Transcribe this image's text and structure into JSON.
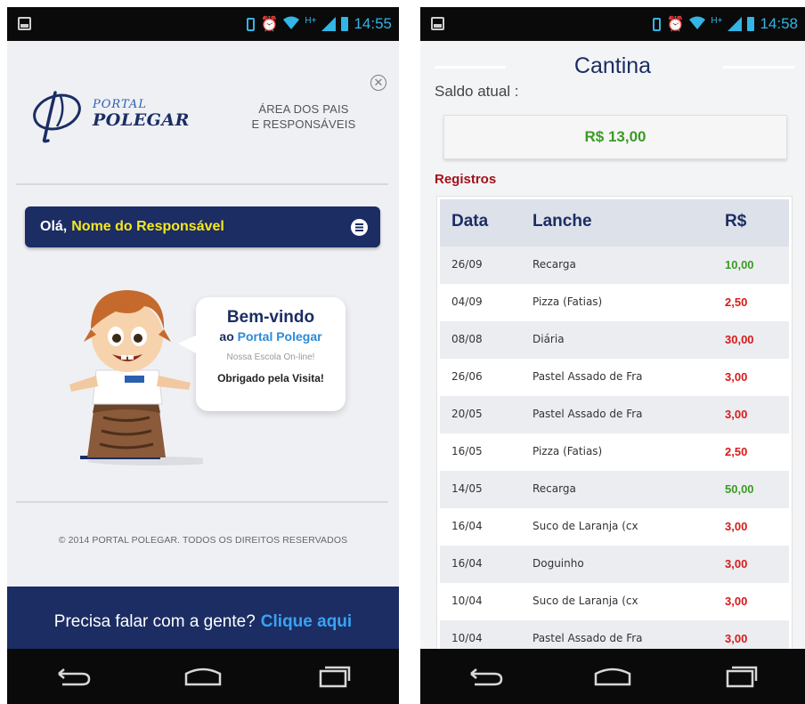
{
  "status_left": {
    "time": "14:55",
    "network": "H+"
  },
  "status_right": {
    "time": "14:58",
    "network": "H+"
  },
  "portal": {
    "logo_line1": "PORTAL",
    "logo_line2": "POLEGAR",
    "area_line1": "ÁREA DOS PAIS",
    "area_line2": "E RESPONSÁVEIS",
    "close_symbol": "✕",
    "greeting_prefix": "Olá,",
    "greeting_name": "Nome do Responsável",
    "bubble_title": "Bem-vindo",
    "bubble_sub_prefix": "ao",
    "bubble_sub_highlight": "Portal Polegar",
    "bubble_tagline": "Nossa Escola On-line!",
    "bubble_thanks": "Obrigado pela Visita!",
    "copyright": "© 2014 PORTAL POLEGAR. TODOS OS DIREITOS RESERVADOS",
    "contact_text": "Precisa falar com a gente?",
    "contact_link": "Clique aqui"
  },
  "cantina": {
    "title": "Cantina",
    "saldo_label": "Saldo atual :",
    "saldo_value": "R$ 13,00",
    "registros_label": "Registros",
    "columns": [
      "Data",
      "Lanche",
      "R$"
    ],
    "rows": [
      {
        "data": "26/09",
        "lanche": "Recarga",
        "valor": "10,00",
        "type": "pos"
      },
      {
        "data": "04/09",
        "lanche": "Pizza (Fatias)",
        "valor": "2,50",
        "type": "neg"
      },
      {
        "data": "08/08",
        "lanche": "Diária",
        "valor": "30,00",
        "type": "neg"
      },
      {
        "data": "26/06",
        "lanche": "Pastel Assado de Fra",
        "valor": "3,00",
        "type": "neg"
      },
      {
        "data": "20/05",
        "lanche": "Pastel Assado de Fra",
        "valor": "3,00",
        "type": "neg"
      },
      {
        "data": "16/05",
        "lanche": "Pizza (Fatias)",
        "valor": "2,50",
        "type": "neg"
      },
      {
        "data": "14/05",
        "lanche": "Recarga",
        "valor": "50,00",
        "type": "pos"
      },
      {
        "data": "16/04",
        "lanche": "Suco de Laranja (cx",
        "valor": "3,00",
        "type": "neg"
      },
      {
        "data": "16/04",
        "lanche": "Doguinho",
        "valor": "3,00",
        "type": "neg"
      },
      {
        "data": "10/04",
        "lanche": "Suco de Laranja (cx",
        "valor": "3,00",
        "type": "neg"
      },
      {
        "data": "10/04",
        "lanche": "Pastel Assado de Fra",
        "valor": "3,00",
        "type": "neg"
      }
    ]
  },
  "colors": {
    "brand_navy": "#1b2d63",
    "highlight_yellow": "#f7e81d",
    "link_blue": "#3aa2f5",
    "positive_green": "#3b9b24",
    "negative_red": "#d91a1a",
    "registros_red": "#a3101b",
    "status_blue": "#33b5e5"
  },
  "icons": {
    "status": [
      "picture-icon",
      "vibrate-icon",
      "alarm-icon",
      "wifi-icon",
      "signal-icon",
      "battery-icon"
    ],
    "nav": [
      "back-icon",
      "home-icon",
      "recents-icon"
    ],
    "menu": "menu-icon",
    "close": "close-icon"
  }
}
